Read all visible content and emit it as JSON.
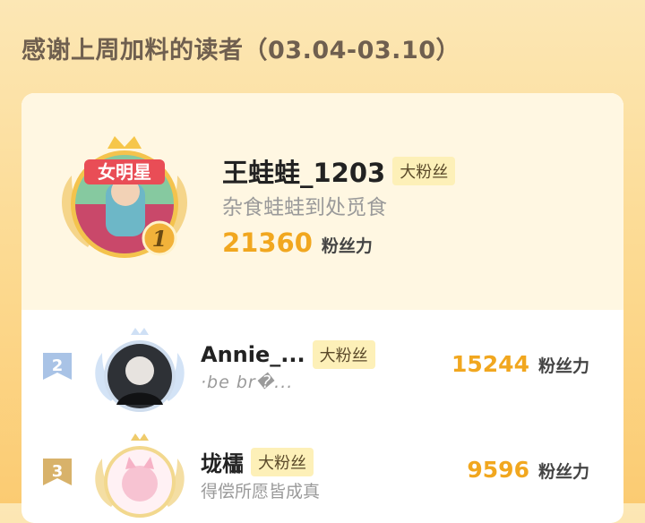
{
  "header": {
    "title": "感谢上周加料的读者（03.04-03.10）"
  },
  "fans_tag": "大粉丝",
  "unit_label": "粉丝力",
  "top_fan": {
    "rank": "1",
    "badge_title": "女明星",
    "name": "王蛙蛙_1203",
    "tag": "大粉丝",
    "subtitle": "杂食蛙蛙到处觅食",
    "score": "21360",
    "unit": "粉丝力"
  },
  "fans": [
    {
      "rank": "2",
      "name": "Annie_...",
      "tag": "大粉丝",
      "subtitle": "·be br�...",
      "score": "15244",
      "unit": "粉丝力"
    },
    {
      "rank": "3",
      "name": "垅櫺",
      "tag": "大粉丝",
      "subtitle": "得偿所愿皆成真",
      "score": "9596",
      "unit": "粉丝力"
    }
  ],
  "colors": {
    "accent": "#F1A71F",
    "tag_bg": "#FDF0B8",
    "page_bg": "#FCD98F"
  }
}
